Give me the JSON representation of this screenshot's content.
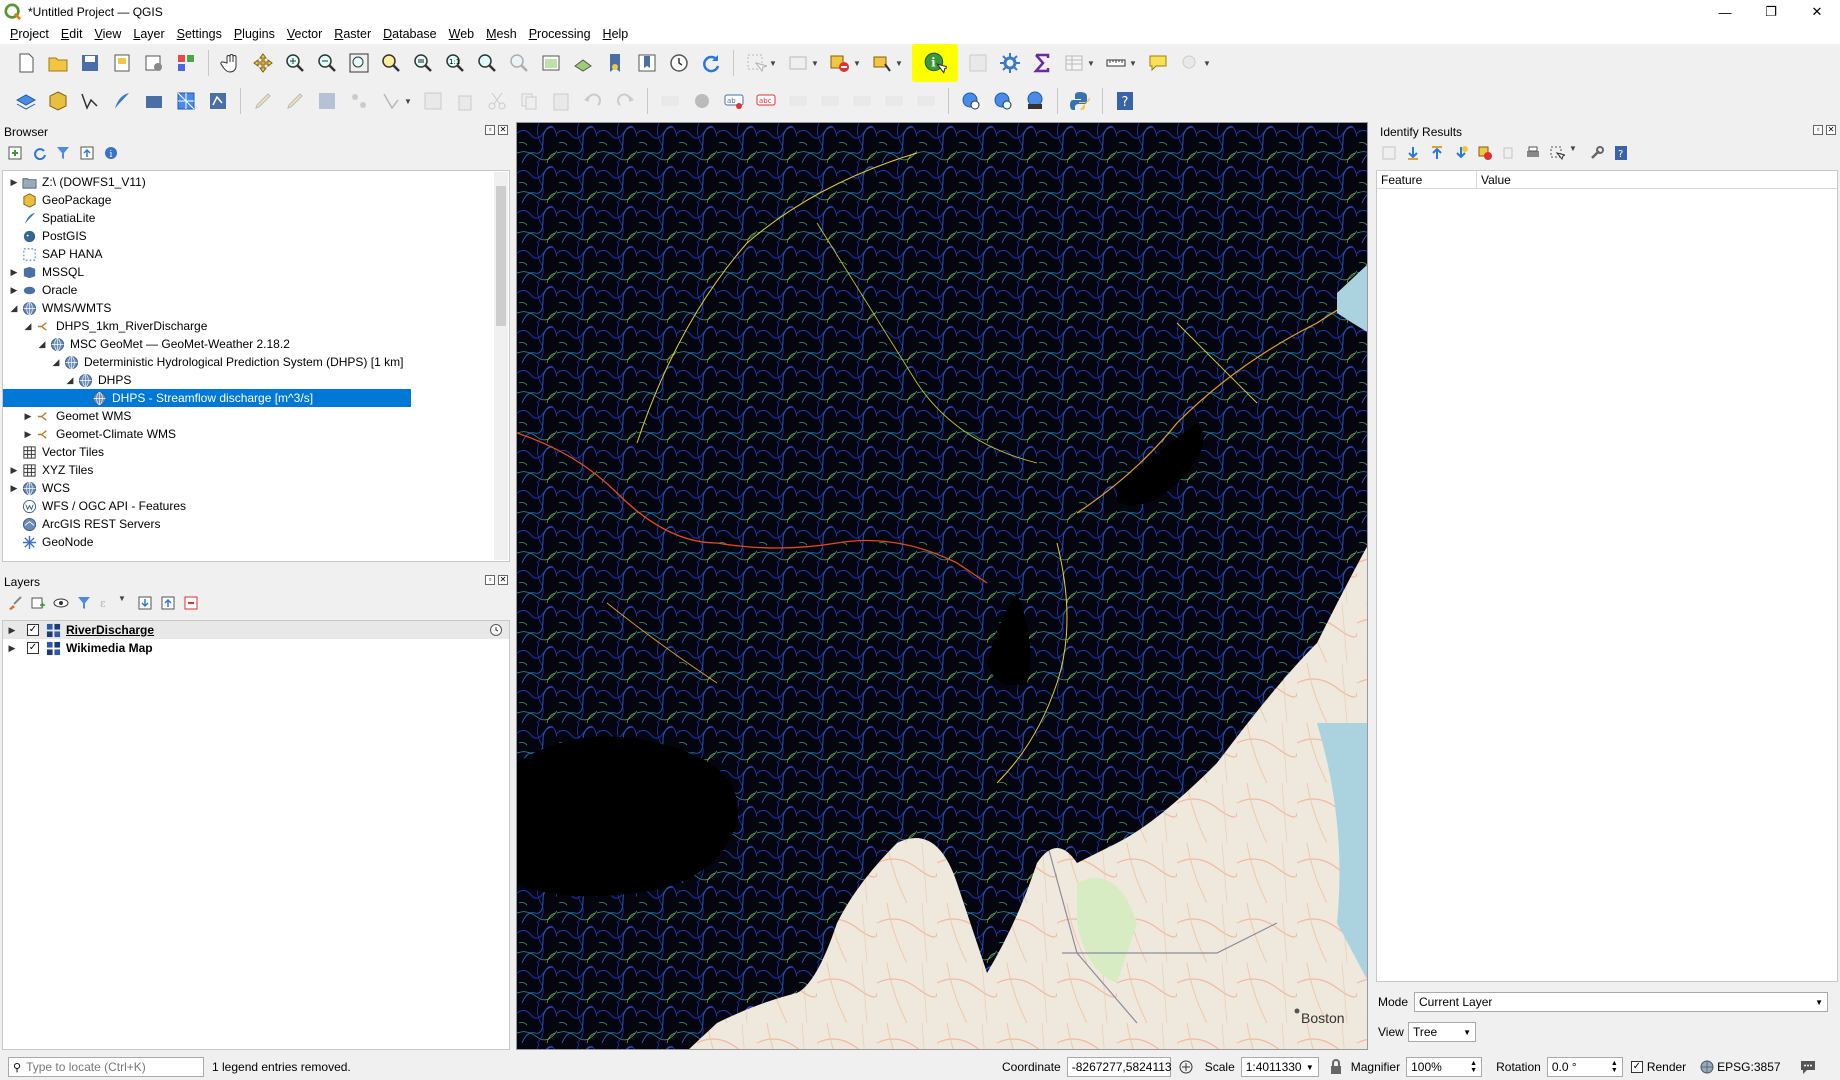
{
  "window": {
    "title": "*Untitled Project — QGIS",
    "minimize": "—",
    "maximize": "❐",
    "close": "✕"
  },
  "menu": [
    "Project",
    "Edit",
    "View",
    "Layer",
    "Settings",
    "Plugins",
    "Vector",
    "Raster",
    "Database",
    "Web",
    "Mesh",
    "Processing",
    "Help"
  ],
  "browser": {
    "title": "Browser",
    "items": [
      {
        "label": "Z:\\ (DOWFS1_V11)",
        "icon": "folder-icon",
        "depth": 0,
        "arrow": "▶"
      },
      {
        "label": "GeoPackage",
        "icon": "geopackage-icon",
        "depth": 0,
        "arrow": ""
      },
      {
        "label": "SpatiaLite",
        "icon": "spatialite-icon",
        "depth": 0,
        "arrow": ""
      },
      {
        "label": "PostGIS",
        "icon": "postgis-icon",
        "depth": 0,
        "arrow": ""
      },
      {
        "label": "SAP HANA",
        "icon": "saphana-icon",
        "depth": 0,
        "arrow": ""
      },
      {
        "label": "MSSQL",
        "icon": "mssql-icon",
        "depth": 0,
        "arrow": "▶"
      },
      {
        "label": "Oracle",
        "icon": "oracle-icon",
        "depth": 0,
        "arrow": "▶"
      },
      {
        "label": "WMS/WMTS",
        "icon": "globe-icon",
        "depth": 0,
        "arrow": "◢"
      },
      {
        "label": "DHPS_1km_RiverDischarge",
        "icon": "connection-icon",
        "depth": 1,
        "arrow": "◢"
      },
      {
        "label": "MSC GeoMet — GeoMet-Weather 2.18.2",
        "icon": "globe-icon",
        "depth": 2,
        "arrow": "◢"
      },
      {
        "label": "Deterministic Hydrological Prediction System (DHPS) [1 km]",
        "icon": "globe-icon",
        "depth": 3,
        "arrow": "◢"
      },
      {
        "label": "DHPS",
        "icon": "globe-icon",
        "depth": 4,
        "arrow": "◢"
      },
      {
        "label": "DHPS - Streamflow discharge [m^3/s]",
        "icon": "globe-icon",
        "depth": 5,
        "arrow": "",
        "selected": true
      },
      {
        "label": "Geomet WMS",
        "icon": "connection-icon",
        "depth": 1,
        "arrow": "▶"
      },
      {
        "label": "Geomet-Climate WMS",
        "icon": "connection-icon",
        "depth": 1,
        "arrow": "▶"
      },
      {
        "label": "Vector Tiles",
        "icon": "grid-icon",
        "depth": 0,
        "arrow": ""
      },
      {
        "label": "XYZ Tiles",
        "icon": "grid-icon",
        "depth": 0,
        "arrow": "▶"
      },
      {
        "label": "WCS",
        "icon": "globe-icon",
        "depth": 0,
        "arrow": "▶"
      },
      {
        "label": "WFS / OGC API - Features",
        "icon": "wfs-icon",
        "depth": 0,
        "arrow": ""
      },
      {
        "label": "ArcGIS REST Servers",
        "icon": "arcgis-icon",
        "depth": 0,
        "arrow": ""
      },
      {
        "label": "GeoNode",
        "icon": "geonode-icon",
        "depth": 0,
        "arrow": ""
      }
    ]
  },
  "layers": {
    "title": "Layers",
    "items": [
      {
        "label": "RiverDischarge",
        "checked": true,
        "underline": true
      },
      {
        "label": "Wikimedia Map",
        "checked": true,
        "underline": false
      }
    ]
  },
  "map": {
    "city_label": "Boston"
  },
  "identify": {
    "title": "Identify Results",
    "columns": [
      "Feature",
      "Value"
    ],
    "mode_label": "Mode",
    "mode_value": "Current Layer",
    "view_label": "View",
    "view_value": "Tree"
  },
  "status": {
    "locate_placeholder": "Type to locate (Ctrl+K)",
    "message": "1 legend entries removed.",
    "coordinate_label": "Coordinate",
    "coordinate_value": "-8267277,5824113",
    "scale_label": "Scale",
    "scale_value": "1:4011330",
    "magnifier_label": "Magnifier",
    "magnifier_value": "100%",
    "rotation_label": "Rotation",
    "rotation_value": "0.0 °",
    "render_label": "Render",
    "crs": "EPSG:3857"
  },
  "colors": {
    "selection": "#0078d7",
    "highlight": "#ffff00",
    "river_low": "#1e3cd2",
    "river_mid": "#2ab0a0",
    "river_high": "#e8d020",
    "river_max": "#e84818"
  }
}
